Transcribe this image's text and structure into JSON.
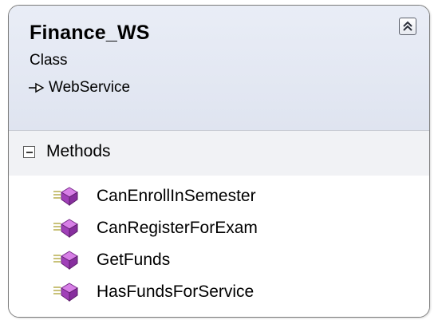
{
  "class_shape": {
    "name": "Finance_WS",
    "stereotype": "Class",
    "base_type": "WebService",
    "collapse_icon": "double-chevron-up-icon"
  },
  "sections": {
    "methods": {
      "label": "Methods",
      "toggle_icon": "minus-box-icon",
      "items": [
        {
          "name": "CanEnrollInSemester",
          "icon": "public-method-icon"
        },
        {
          "name": "CanRegisterForExam",
          "icon": "public-method-icon"
        },
        {
          "name": "GetFunds",
          "icon": "public-method-icon"
        },
        {
          "name": "HasFundsForService",
          "icon": "public-method-icon"
        }
      ]
    }
  },
  "colors": {
    "header_bg": "#e3e7f2",
    "border": "#7d7d7d",
    "method_icon": "#b04fc8"
  }
}
